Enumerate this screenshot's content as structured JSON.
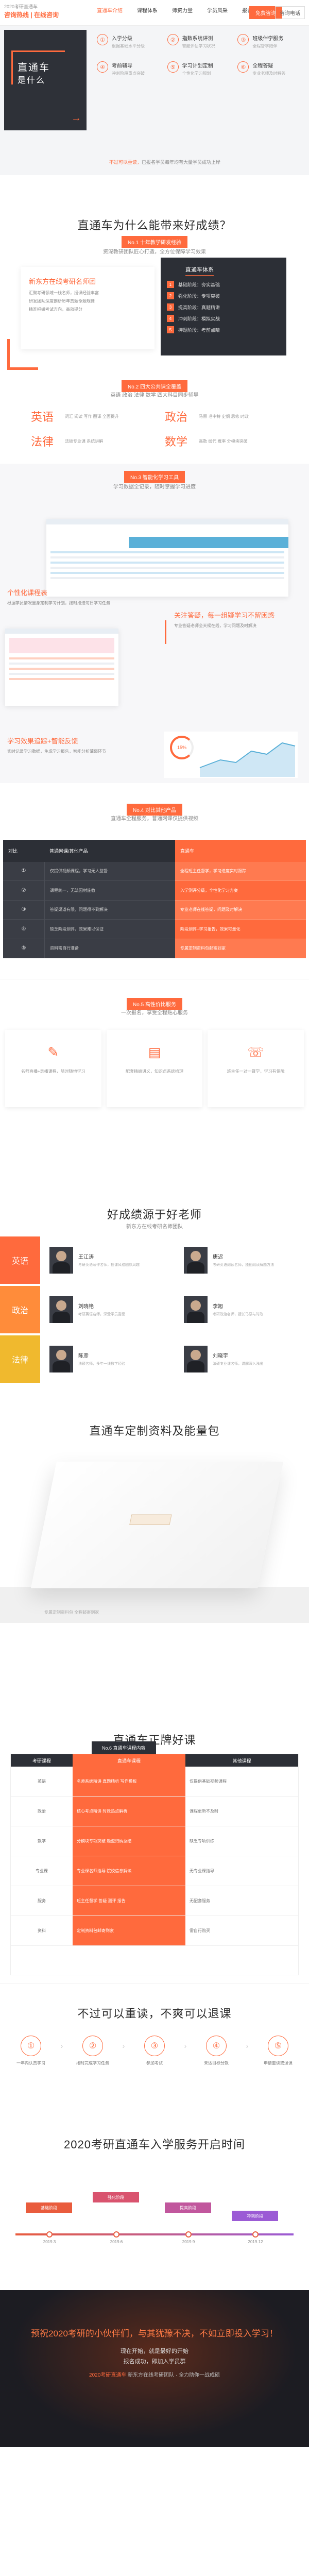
{
  "header": {
    "logo_line1": "2020考研直通车",
    "logo_line2": "咨询热线 | 在线咨询",
    "nav": [
      "直通车介绍",
      "课程体系",
      "师资力量",
      "学员风采",
      "报名流程"
    ],
    "consult_button": "免费咨询",
    "tel_button": "咨询电话"
  },
  "hero": {
    "card_title": "直通车",
    "card_sub": "是什么",
    "features": [
      {
        "icon": "①",
        "title": "入学分级",
        "desc": "根据基础水平分级"
      },
      {
        "icon": "②",
        "title": "指数系统评测",
        "desc": "智能评估学习状况"
      },
      {
        "icon": "③",
        "title": "班级伴学服务",
        "desc": "全程督学陪伴"
      },
      {
        "icon": "④",
        "title": "考前辅导",
        "desc": "冲刺阶段重点突破"
      },
      {
        "icon": "⑤",
        "title": "学习计划定制",
        "desc": "个性化学习规划"
      },
      {
        "icon": "⑥",
        "title": "全程答疑",
        "desc": "专业老师及时解答"
      }
    ],
    "tip_prefix": "不过可以重读，",
    "tip_text": "已报名学员每年均有大量学员成功上岸"
  },
  "why": {
    "title": "直通车为什么能带来好成绩？",
    "tag": "No.1 十年教学研发经验",
    "sub": "资深教研团队匠心打造，全方位保障学习效果",
    "lcard_title": "新东方在线考研名师团",
    "lcard_lines": [
      "汇聚考研领域一线名师，授课经验丰富",
      "研发团队深度剖析历年真题命题规律",
      "精准把握考试方向，高效提分"
    ],
    "rcard_title": "直通车体系",
    "rcard_rows": [
      "基础阶段：夯实基础",
      "强化阶段：专项突破",
      "提高阶段：真题精讲",
      "冲刺阶段：模拟实战",
      "押题阶段：考前点睛"
    ],
    "tag2": "No.2 四大公共课全覆盖",
    "sub2": "英语 政治 法律 数学 四大科目同步辅导",
    "subjects": [
      {
        "name": "英语",
        "desc": "词汇 阅读 写作 翻译 全面提升"
      },
      {
        "name": "政治",
        "desc": "马原 毛中特 史纲 思修 时政"
      },
      {
        "name": "法律",
        "desc": "法硕专业课 系统讲解"
      },
      {
        "name": "数学",
        "desc": "高数 线代 概率 分模块突破"
      }
    ]
  },
  "tools": {
    "tag": "No.3 智能化学习工具",
    "sub": "学习数据全记录，随时掌握学习进度",
    "f1_title": "个性化课程表",
    "f1_desc": "根据学员情况量身定制学习计划，按时推送每日学习任务",
    "f2_title": "关注答疑，每一组疑学习不留困惑",
    "f2_desc": "专业答疑老师全天候在线，学习问题及时解决",
    "f3_title": "学习效果追踪+智能反馈",
    "f3_desc": "实时记录学习数据，生成学习报告，智能分析薄弱环节",
    "ring_value": "15%"
  },
  "compare": {
    "tag": "No.4 对比其他产品",
    "sub": "直通车全程服务，普通网课仅提供视频",
    "headers": [
      "对比",
      "普通网课/其他产品",
      "直通车"
    ],
    "rows": [
      {
        "k": "①",
        "a": "仅提供视频课程，学习无人监督",
        "b": "全程班主任督学，学习进度实时跟踪"
      },
      {
        "k": "②",
        "a": "课程统一，无法因材施教",
        "b": "入学测评分级，个性化学习方案"
      },
      {
        "k": "③",
        "a": "答疑渠道有限，问题得不到解决",
        "b": "专业老师在线答疑，问题及时解决"
      },
      {
        "k": "④",
        "a": "缺乏阶段测评，效果难以保证",
        "b": "阶段测评+学习报告，效果可量化"
      },
      {
        "k": "⑤",
        "a": "资料需自行准备",
        "b": "专属定制资料包邮寄到家"
      }
    ]
  },
  "value": {
    "tag": "No.5 高性价比服务",
    "sub": "一次报名，享受全程贴心服务",
    "cards": [
      {
        "icon": "✎",
        "desc": "名师直播+录播课程，随时随地学习"
      },
      {
        "icon": "▤",
        "desc": "配套精编讲义，知识点系统梳理"
      },
      {
        "icon": "☏",
        "desc": "班主任一对一督学，学习有保障"
      }
    ]
  },
  "teachers": {
    "title": "好成绩源于好老师",
    "sub": "新东方在线考研名师团队",
    "rows": [
      {
        "subject": "英语",
        "color": "#ff6a3d",
        "t1": "王江涛",
        "d1": "考研英语写作名师，授课风格幽默风趣",
        "t2": "唐迟",
        "d2": "考研英语阅读名师，独创阅读解题方法"
      },
      {
        "subject": "政治",
        "color": "#ff8c3a",
        "t1": "刘晓艳",
        "d1": "考研英语名师，深受学员喜爱",
        "t2": "李旭",
        "d2": "考研政治名师，擅长马原与时政"
      },
      {
        "subject": "法律",
        "color": "#f0b92e",
        "t1": "陈彦",
        "d1": "法硕名师，多年一线教学经验",
        "t2": "刘晓宇",
        "d2": "法硕专业课名师，讲解深入浅出"
      }
    ]
  },
  "package": {
    "title": "直通车定制资料及能量包",
    "note": "专属定制资料包 全程邮寄到家"
  },
  "good": {
    "title": "直通车正牌好课",
    "badge": "No.6 直通车课程内容",
    "headers": [
      "考研课程",
      "直通车课程",
      "其他课程"
    ],
    "rows": [
      {
        "k": "英语",
        "a": "名师系统精讲 真题精析 写作模板",
        "b": "仅提供基础视频课程"
      },
      {
        "k": "政治",
        "a": "核心考点精讲 时政热点解析",
        "b": "课程更新不及时"
      },
      {
        "k": "数学",
        "a": "分模块专项突破 题型归纳总结",
        "b": "缺乏专项训练"
      },
      {
        "k": "专业课",
        "a": "专业课名师指导 院校信息解读",
        "b": "无专业课指导"
      },
      {
        "k": "服务",
        "a": "班主任督学 答疑 测评 报告",
        "b": "无配套服务"
      },
      {
        "k": "资料",
        "a": "定制资料包邮寄到家",
        "b": "需自行购买"
      }
    ]
  },
  "refund": {
    "title": "不过可以重读，不爽可以退课",
    "steps": [
      {
        "icon": "①",
        "desc": "一年内认真学习"
      },
      {
        "icon": "②",
        "desc": "按时完成学习任务"
      },
      {
        "icon": "③",
        "desc": "参加考试"
      },
      {
        "icon": "④",
        "desc": "未达目标分数"
      },
      {
        "icon": "⑤",
        "desc": "申请重读或退课"
      }
    ]
  },
  "time": {
    "title": "2020考研直通车入学服务开启时间",
    "blocks": [
      {
        "text": "基础阶段",
        "color": "#e95c3d"
      },
      {
        "text": "强化阶段",
        "color": "#d9536e"
      },
      {
        "text": "提高阶段",
        "color": "#c1579d"
      },
      {
        "text": "冲刺阶段",
        "color": "#9b5bd5"
      }
    ],
    "dates": [
      "2019.3",
      "2019.6",
      "2019.9",
      "2019.12"
    ]
  },
  "footer": {
    "head": "预祝2020考研的小伙伴们，与其犹豫不决，不如立即投入学习！",
    "l2": "现在开始，就是最好的开始",
    "l3": "报名成功，即加入学员群",
    "btm_prefix": "2020考研直通车",
    "btm_text": "新东方在线考研团队 · 全力助你一战成硕"
  }
}
